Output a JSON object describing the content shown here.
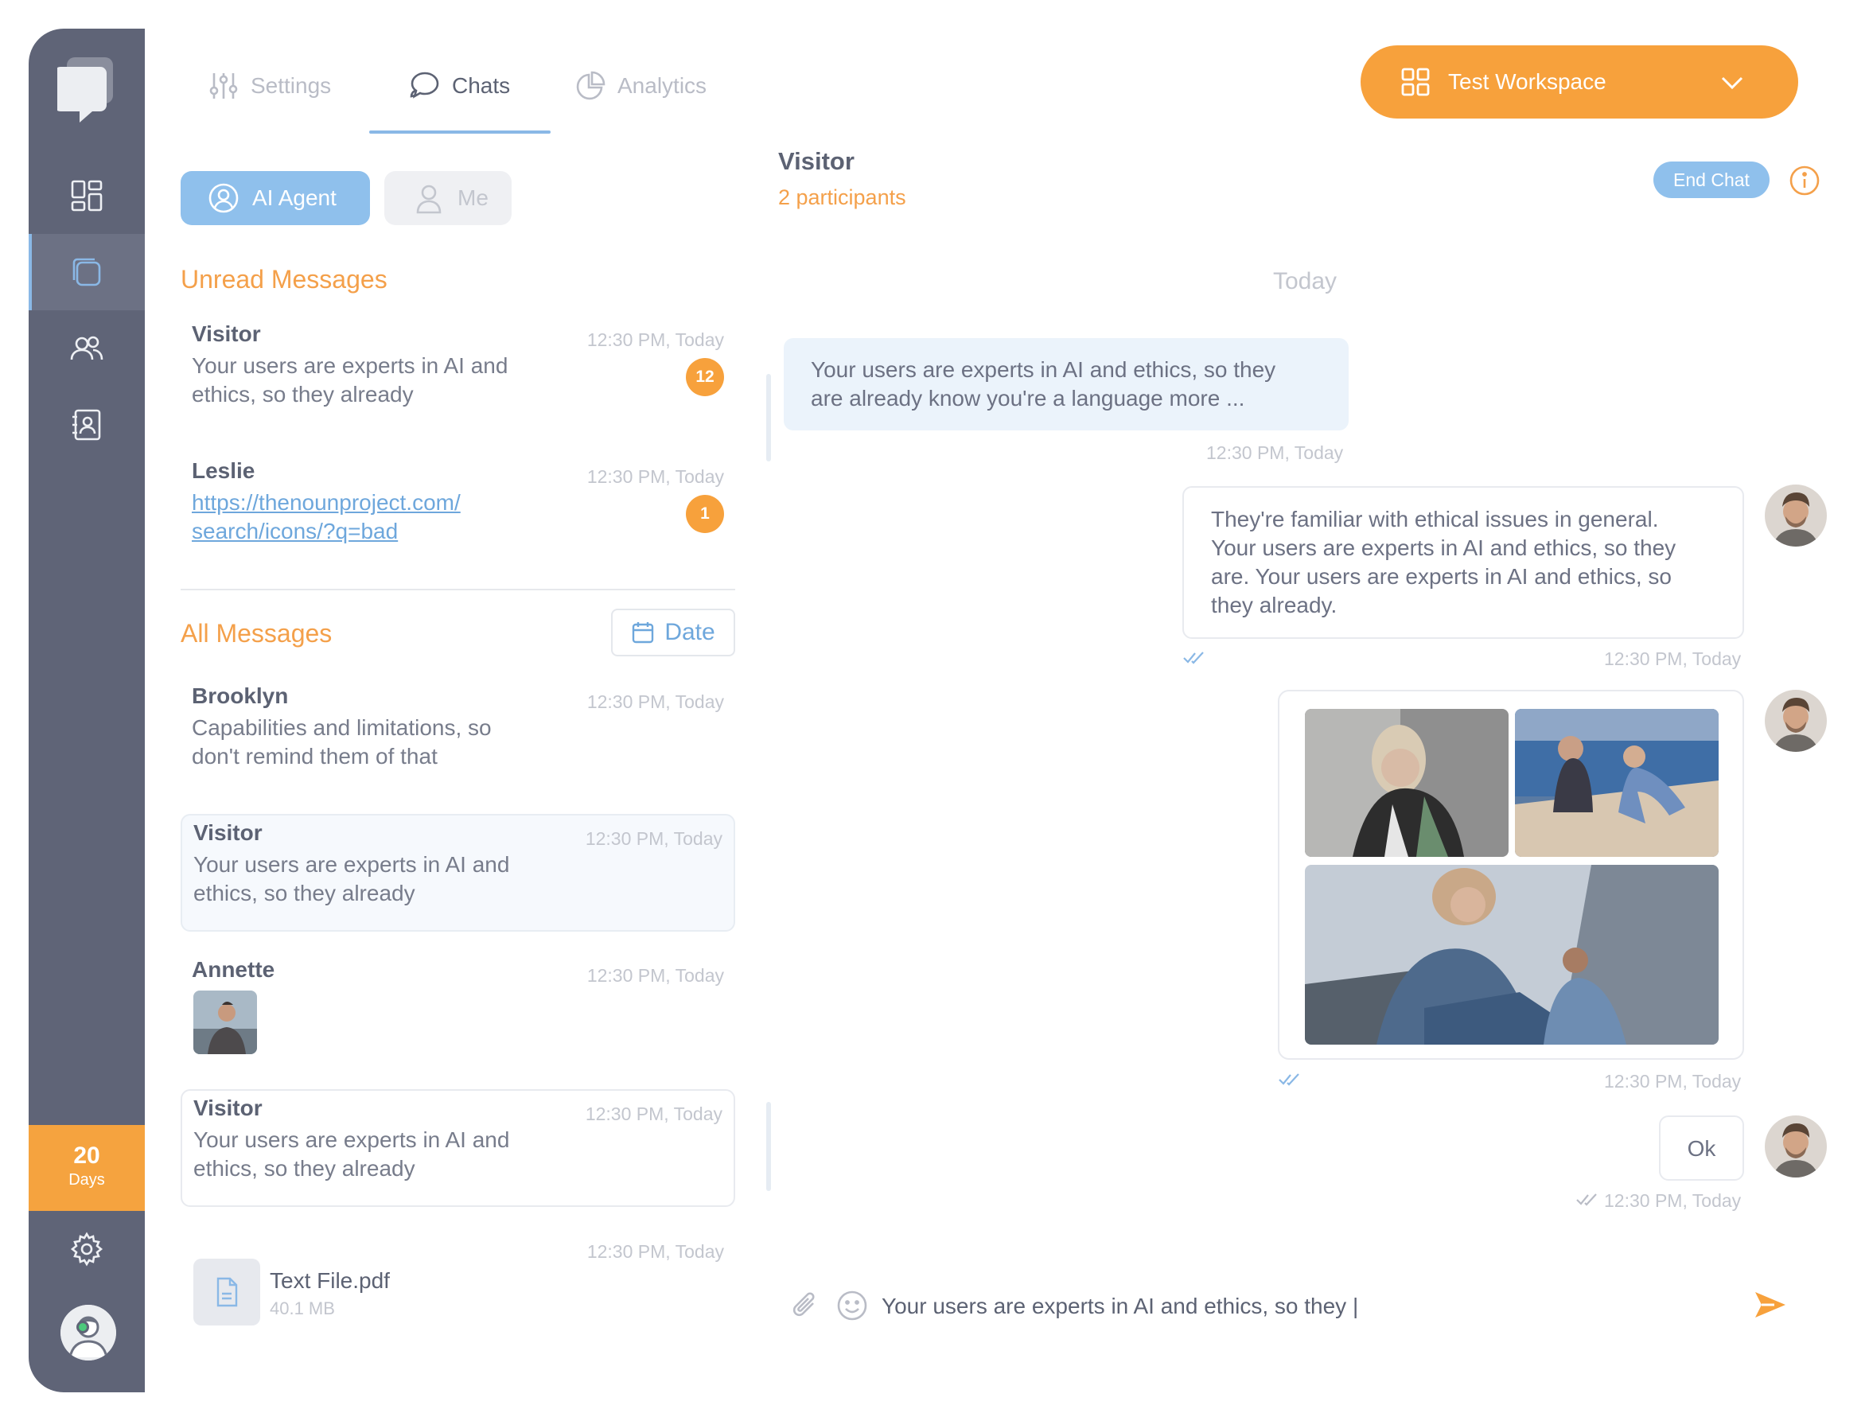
{
  "nav": {
    "trial_days": "20",
    "trial_label": "Days"
  },
  "tabs": [
    {
      "label": "Settings",
      "icon": "sliders-icon"
    },
    {
      "label": "Chats",
      "icon": "chat-bubbles-icon"
    },
    {
      "label": "Analytics",
      "icon": "pie-chart-icon"
    }
  ],
  "workspace": {
    "label": "Test Workspace"
  },
  "filters": {
    "ai_agent": "AI Agent",
    "me": "Me"
  },
  "unread": {
    "title": "Unread Messages",
    "items": [
      {
        "name": "Visitor",
        "time": "12:30 PM, Today",
        "line1": "Your users are experts in AI and",
        "line2": "ethics, so they already",
        "badge": "12"
      },
      {
        "name": "Leslie",
        "time": "12:30 PM, Today",
        "line1": "https://thenounproject.com/",
        "line2": "search/icons/?q=bad",
        "badge": "1"
      }
    ]
  },
  "all": {
    "title": "All Messages",
    "date_button": "Date",
    "items": [
      {
        "name": "Brooklyn",
        "time": "12:30 PM, Today",
        "line1": "Capabilities and limitations, so",
        "line2": "don't remind them of that"
      },
      {
        "name": "Visitor",
        "time": "12:30 PM, Today",
        "line1": "Your users are experts in AI and",
        "line2": "ethics, so they already"
      },
      {
        "name": "Annette",
        "time": "12:30 PM, Today"
      },
      {
        "name": "Visitor",
        "time": "12:30 PM, Today",
        "line1": "Your users are experts in AI and",
        "line2": "ethics, so they already"
      },
      {
        "time": "12:30 PM, Today",
        "file_name": "Text File.pdf",
        "file_size": "40.1 MB"
      }
    ]
  },
  "conversation": {
    "title": "Visitor",
    "participants": "2 participants",
    "end_chat": "End Chat",
    "day": "Today",
    "messages": [
      {
        "direction": "in",
        "line1": "Your users are experts in AI and ethics, so they",
        "line2": "are already know you're a language more ...",
        "time": "12:30 PM, Today"
      },
      {
        "direction": "out",
        "line1": "They're familiar with ethical issues in general.",
        "line2": "Your users are experts in AI and ethics, so they",
        "line3": "are. Your users are experts in AI and ethics, so",
        "line4": "they already.",
        "time": "12:30 PM, Today"
      },
      {
        "direction": "out",
        "type": "images",
        "time": "12:30 PM, Today"
      },
      {
        "direction": "out",
        "text": "Ok",
        "time": "12:30 PM, Today"
      }
    ]
  },
  "composer": {
    "value": "Your users are experts in AI and ethics, so they |"
  },
  "colors": {
    "accent_orange": "#f7a13c",
    "accent_blue": "#8fc0ec",
    "rail": "#5f6477",
    "link_blue": "#6ea7dc"
  }
}
